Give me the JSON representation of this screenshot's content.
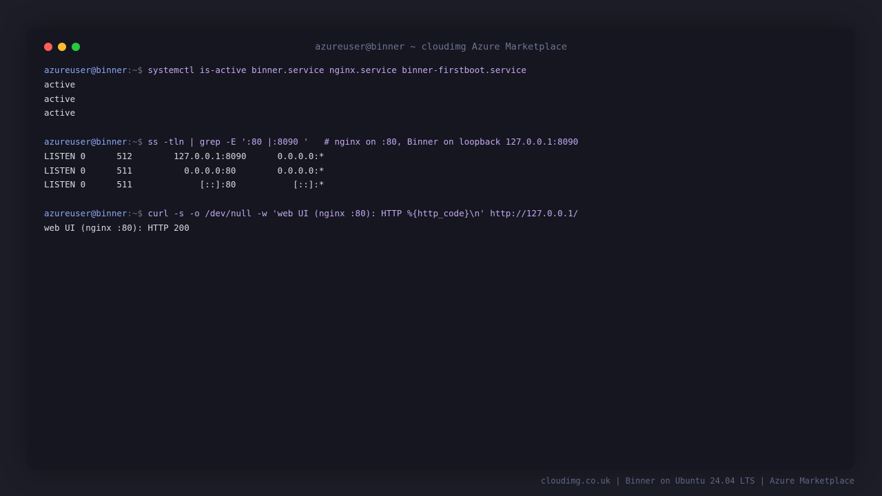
{
  "window": {
    "title": "azureuser@binner ~ cloudimg Azure Marketplace"
  },
  "prompt": {
    "user_host": "azureuser@binner",
    "path_symbol": ":~$"
  },
  "blocks": [
    {
      "command": "systemctl is-active binner.service nginx.service binner-firstboot.service",
      "output": [
        "active",
        "active",
        "active"
      ]
    },
    {
      "command": "ss -tln | grep -E ':80 |:8090 '   # nginx on :80, Binner on loopback 127.0.0.1:8090",
      "output": [
        "LISTEN 0      512        127.0.0.1:8090      0.0.0.0:*",
        "LISTEN 0      511          0.0.0.0:80        0.0.0.0:*",
        "LISTEN 0      511             [::]:80           [::]:*"
      ]
    },
    {
      "command": "curl -s -o /dev/null -w 'web UI (nginx :80): HTTP %{http_code}\\n' http://127.0.0.1/",
      "output": [
        "web UI (nginx :80): HTTP 200"
      ]
    }
  ],
  "footer": {
    "text": "cloudimg.co.uk | Binner on Ubuntu 24.04 LTS | Azure Marketplace"
  },
  "colors": {
    "background": "#1c1d27",
    "window": "#151620",
    "prompt_user": "#8ea6f2",
    "command": "#c3a8ee",
    "output": "#d6d8e2",
    "dot_red": "#ff5f57",
    "dot_yellow": "#febc2e",
    "dot_green": "#28c840"
  }
}
